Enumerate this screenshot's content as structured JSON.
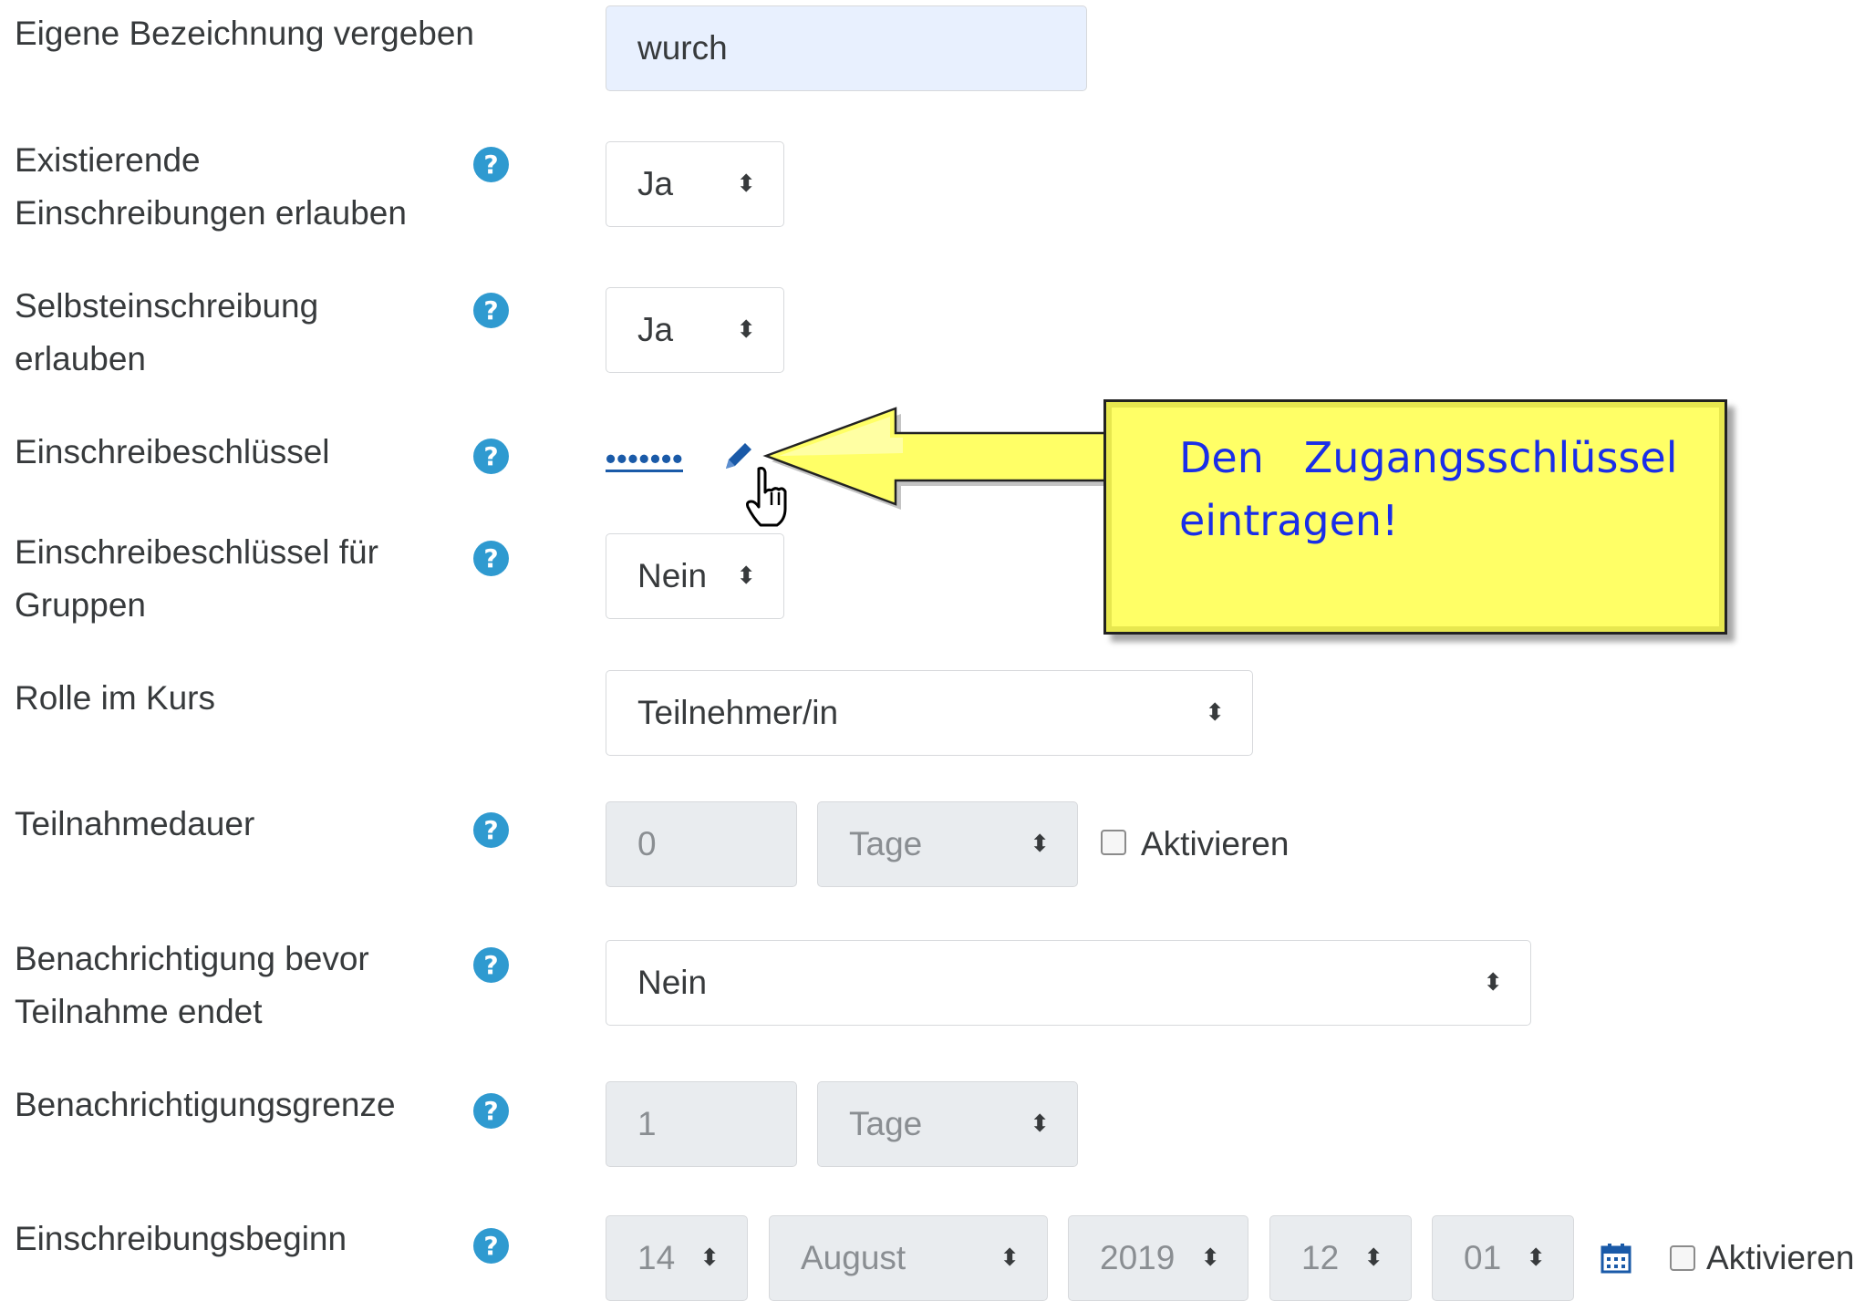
{
  "fields": {
    "name": {
      "label": "Eigene Bezeichnung vergeben",
      "value": "wurch"
    },
    "existing": {
      "label1": "Existierende",
      "label2": "Einschreibungen erlauben",
      "value": "Ja"
    },
    "self": {
      "label1": "Selbsteinschreibung",
      "label2": "erlauben",
      "value": "Ja"
    },
    "key": {
      "label": "Einschreibeschlüssel",
      "value": "•••••••"
    },
    "groupkey": {
      "label1": "Einschreibeschlüssel für",
      "label2": "Gruppen",
      "value": "Nein"
    },
    "role": {
      "label": "Rolle im Kurs",
      "value": "Teilnehmer/in"
    },
    "duration": {
      "label": "Teilnahmedauer",
      "value": "0",
      "unit": "Tage",
      "enable": "Aktivieren"
    },
    "notify": {
      "label1": "Benachrichtigung bevor",
      "label2": "Teilnahme endet",
      "value": "Nein"
    },
    "threshold": {
      "label": "Benachrichtigungsgrenze",
      "value": "1",
      "unit": "Tage"
    },
    "start": {
      "label": "Einschreibungsbeginn",
      "day": "14",
      "month": "August",
      "year": "2019",
      "hour": "12",
      "minute": "01",
      "enable": "Aktivieren"
    }
  },
  "help_icon": "?",
  "arrow_glyph": "⬍",
  "callout": {
    "line1": "Den   Zugangsschlüssel",
    "line2": "eintragen!",
    "text_color": "#1a2ee8",
    "fill": "#ffff66"
  },
  "colors": {
    "help": "#2f9ad0",
    "link": "#1a5aa8",
    "field_disabled": "#e9ecef",
    "name_field_bg": "#e8f0fe"
  }
}
